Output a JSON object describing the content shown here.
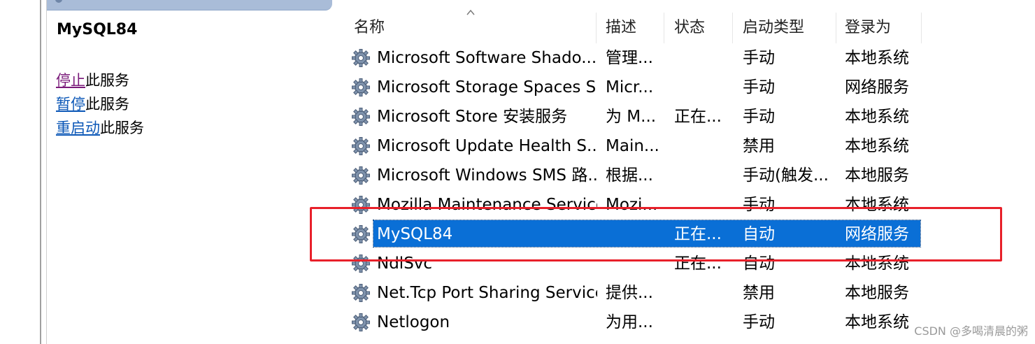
{
  "details": {
    "service_title": "MySQL84",
    "actions": [
      {
        "link": "停止",
        "suffix": "此服务"
      },
      {
        "link": "暂停",
        "suffix": "此服务"
      },
      {
        "link": "重启动",
        "suffix": "此服务"
      }
    ]
  },
  "columns": {
    "name": "名称",
    "description": "描述",
    "status": "状态",
    "startup_type": "启动类型",
    "log_on_as": "登录为"
  },
  "rows": [
    {
      "name": "Microsoft Software Shado...",
      "description": "管理...",
      "status": "",
      "startup_type": "手动",
      "log_on_as": "本地系统"
    },
    {
      "name": "Microsoft Storage Spaces S...",
      "description": "Micr...",
      "status": "",
      "startup_type": "手动",
      "log_on_as": "网络服务"
    },
    {
      "name": "Microsoft Store 安装服务",
      "description": "为 M...",
      "status": "正在...",
      "startup_type": "手动",
      "log_on_as": "本地系统"
    },
    {
      "name": "Microsoft Update Health S...",
      "description": "Main...",
      "status": "",
      "startup_type": "禁用",
      "log_on_as": "本地系统"
    },
    {
      "name": "Microsoft Windows SMS 路...",
      "description": "根据...",
      "status": "",
      "startup_type": "手动(触发...",
      "log_on_as": "本地服务"
    },
    {
      "name": "Mozilla Maintenance Service",
      "description": "Mozi...",
      "status": "",
      "startup_type": "手动",
      "log_on_as": "本地系统"
    },
    {
      "name": "MySQL84",
      "description": "",
      "status": "正在...",
      "startup_type": "自动",
      "log_on_as": "网络服务",
      "selected": true
    },
    {
      "name": "NdlSvc",
      "description": "",
      "status": "正在...",
      "startup_type": "自动",
      "log_on_as": "本地系统"
    },
    {
      "name": "Net.Tcp Port Sharing Service",
      "description": "提供...",
      "status": "",
      "startup_type": "禁用",
      "log_on_as": "本地服务"
    },
    {
      "name": "Netlogon",
      "description": "为用...",
      "status": "",
      "startup_type": "手动",
      "log_on_as": "本地系统"
    }
  ],
  "colors": {
    "selection": "#0a6fd6",
    "highlight_box": "#e8202a",
    "link_visited": "#7a1a7a",
    "link": "#0b57b7"
  },
  "icons": {
    "service_row": "gear-icon",
    "sort": "sort-ascending-icon"
  },
  "watermark": "CSDN @多喝清晨的粥"
}
